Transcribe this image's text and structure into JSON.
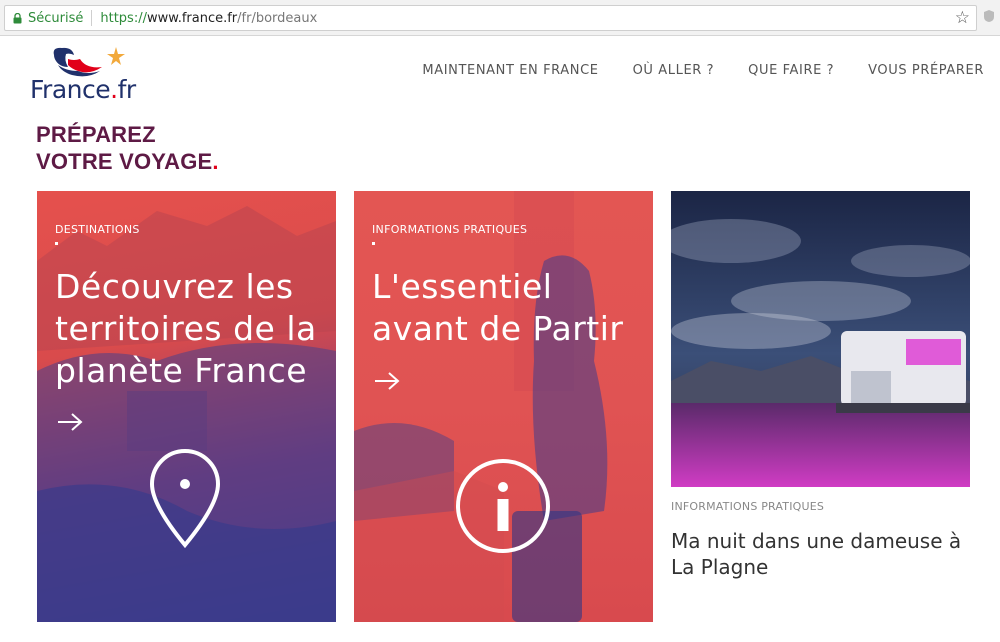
{
  "browser": {
    "secure_label": "Sécurisé",
    "url_scheme": "https://",
    "url_host": "www.france.fr",
    "url_path": "/fr/bordeaux"
  },
  "header": {
    "logo_text": "France",
    "logo_dot": ".",
    "logo_suffix": "fr",
    "nav": [
      {
        "label": "MAINTENANT EN FRANCE"
      },
      {
        "label": "OÙ ALLER ?"
      },
      {
        "label": "QUE FAIRE ?"
      },
      {
        "label": "VOUS PRÉPARER"
      }
    ]
  },
  "page": {
    "title_line1": "PRÉPAREZ",
    "title_line2": "VOTRE VOYAGE",
    "title_dot": "."
  },
  "cards": [
    {
      "category": "DESTINATIONS",
      "heading": "Découvrez les territoires de la planète France",
      "icon": "map-pin-icon"
    },
    {
      "category": "INFORMATIONS PRATIQUES",
      "heading": "L'essentiel avant de Partir",
      "icon": "info-icon"
    },
    {
      "category": "INFORMATIONS PRATIQUES",
      "heading": "Ma nuit dans une dameuse à La Plagne"
    }
  ],
  "colors": {
    "title": "#5e1a45",
    "accent_red": "#e1001a",
    "card_red": "#e05353",
    "card_blue": "#3f3d8c",
    "secure_green": "#2e8b3a"
  }
}
